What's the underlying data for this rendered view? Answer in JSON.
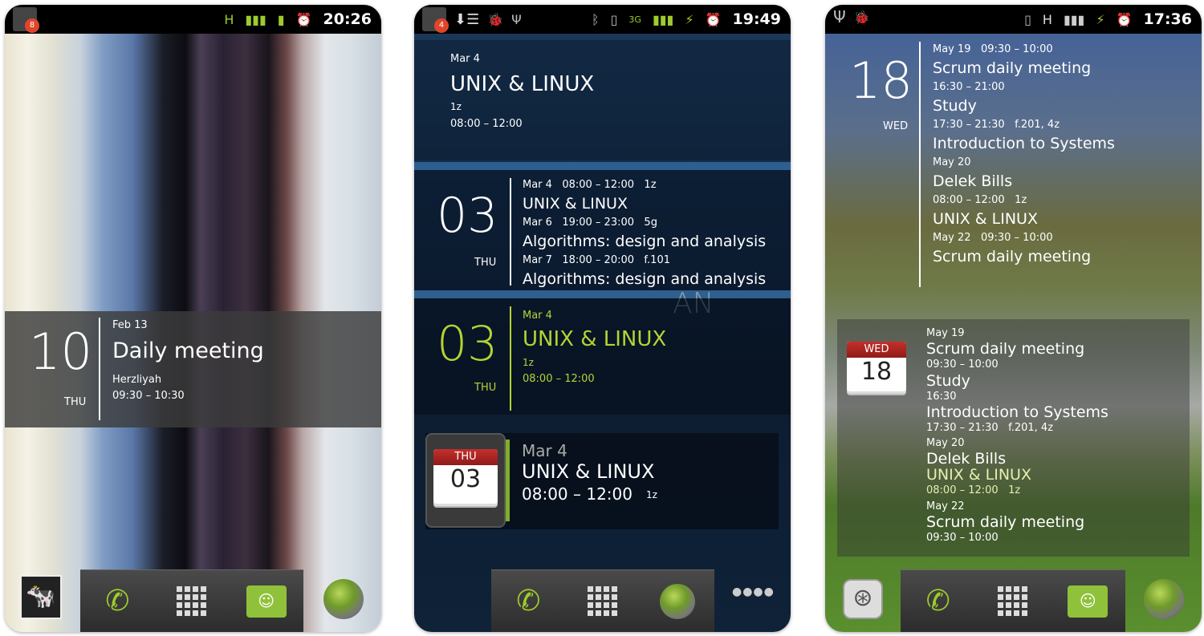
{
  "phone1": {
    "status": {
      "time": "20:26",
      "notification_count": "8",
      "network": "H"
    },
    "widget": {
      "day_number": "10",
      "weekday": "THU",
      "date": "Feb 13",
      "title": "Daily meeting",
      "location": "Herzliyah",
      "time": "09:30 – 10:30"
    }
  },
  "phone2": {
    "status": {
      "time": "19:49",
      "notification_count": "4",
      "network": "3G"
    },
    "widget_top": {
      "date": "Mar 4",
      "title": "UNIX & LINUX",
      "location": "1z",
      "time": "08:00 – 12:00"
    },
    "widget_list": {
      "day_number": "03",
      "weekday": "THU",
      "lines": [
        {
          "text": "Mar 4   08:00 – 12:00   1z",
          "style": "sm"
        },
        {
          "text": "UNIX & LINUX",
          "style": "lg"
        },
        {
          "text": "Mar 6   19:00 – 23:00   5g",
          "style": "sm"
        },
        {
          "text": "Algorithms: design and analysis",
          "style": "lg"
        },
        {
          "text": "Mar 7   18:00 – 20:00   f.101",
          "style": "sm"
        },
        {
          "text": "Algorithms: design and analysis",
          "style": "lg"
        }
      ]
    },
    "widget_green": {
      "day_number": "03",
      "weekday": "THU",
      "date": "Mar 4",
      "title": "UNIX & LINUX",
      "location": "1z",
      "time": "08:00 – 12:00",
      "accent": "#b5d334"
    },
    "widget_calendar": {
      "weekday": "THU",
      "day_number": "03",
      "date": "Mar 4",
      "title": "UNIX & LINUX",
      "time": "08:00 – 12:00",
      "location": "1z"
    },
    "watermark": "AN"
  },
  "phone3": {
    "status": {
      "time": "17:36",
      "network": "H"
    },
    "widget_top": {
      "day_number": "18",
      "weekday": "WED",
      "lines": [
        {
          "text": "May 19   09:30 – 10:00",
          "style": "sm"
        },
        {
          "text": "Scrum daily meeting",
          "style": "lg"
        },
        {
          "text": "16:30 – 21:00",
          "style": "sm"
        },
        {
          "text": "Study",
          "style": "lg"
        },
        {
          "text": "17:30 – 21:30   f.201, 4z",
          "style": "sm"
        },
        {
          "text": "Introduction to Systems",
          "style": "lg"
        },
        {
          "text": "May 20",
          "style": "sm"
        },
        {
          "text": "Delek Bills",
          "style": "lg"
        },
        {
          "text": "08:00 – 12:00   1z",
          "style": "sm"
        },
        {
          "text": "UNIX & LINUX",
          "style": "lg"
        },
        {
          "text": "May 22   09:30 – 10:00",
          "style": "sm"
        },
        {
          "text": "Scrum daily meeting",
          "style": "lg"
        }
      ]
    },
    "widget_box": {
      "weekday": "WED",
      "day_number": "18",
      "lines": [
        {
          "text": "May 19",
          "style": "sm"
        },
        {
          "text": "Scrum daily meeting",
          "style": "lg"
        },
        {
          "text": "09:30 – 10:00",
          "style": "sm"
        },
        {
          "text": "Study",
          "style": "lg"
        },
        {
          "text": "16:30",
          "style": "sm"
        },
        {
          "text": "Introduction to Systems",
          "style": "lg"
        },
        {
          "text": "17:30 – 21:30   f.201, 4z",
          "style": "sm"
        },
        {
          "text": "May 20",
          "style": "sm"
        },
        {
          "text": "Delek Bills",
          "style": "lg"
        },
        {
          "text": "UNIX & LINUX",
          "style": "lg",
          "color": "#e6efb0"
        },
        {
          "text": "08:00 – 12:00   1z",
          "style": "sm",
          "color": "#e6efb0"
        },
        {
          "text": "May 22",
          "style": "sm"
        },
        {
          "text": "Scrum daily meeting",
          "style": "lg"
        },
        {
          "text": "09:30 – 10:00",
          "style": "sm"
        }
      ]
    }
  }
}
